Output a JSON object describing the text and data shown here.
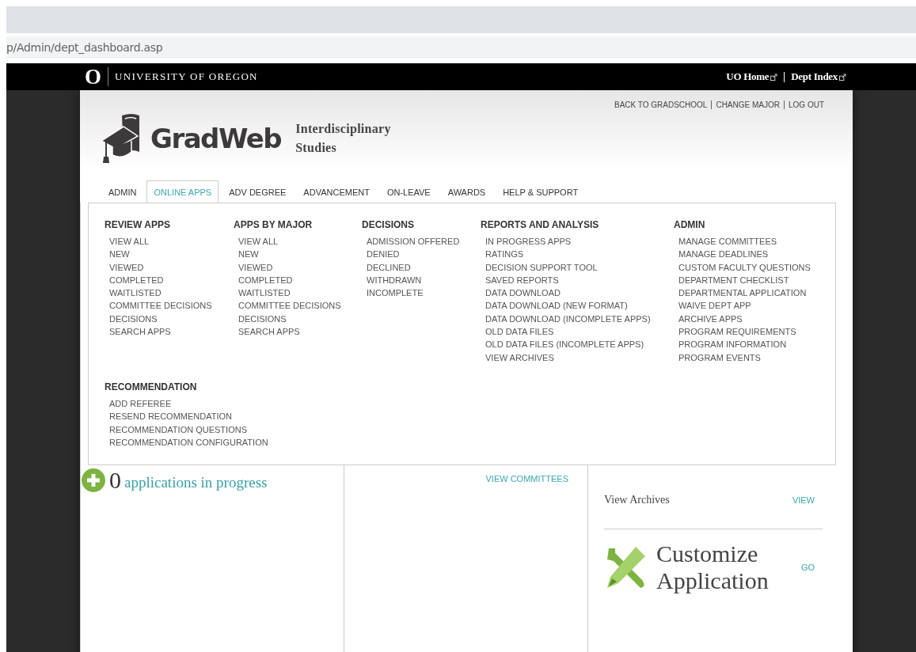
{
  "browser": {
    "url": "p/Admin/dept_dashboard.asp"
  },
  "top_bar": {
    "logo_letter": "O",
    "wordmark": "UNIVERSITY OF OREGON",
    "links": [
      "UO Home",
      "Dept Index"
    ]
  },
  "header": {
    "logo": "GradWeb",
    "department": "Interdisciplinary Studies",
    "utility_links": [
      "BACK TO GRADSCHOOL",
      "CHANGE MAJOR",
      "LOG OUT"
    ]
  },
  "tabs": [
    {
      "label": "ADMIN",
      "selected": false
    },
    {
      "label": "ONLINE APPS",
      "selected": true
    },
    {
      "label": "ADV DEGREE",
      "selected": false
    },
    {
      "label": "ADVANCEMENT",
      "selected": false
    },
    {
      "label": "ON-LEAVE",
      "selected": false
    },
    {
      "label": "AWARDS",
      "selected": false
    },
    {
      "label": "HELP & SUPPORT",
      "selected": false
    }
  ],
  "menu": {
    "sections": [
      {
        "title": "REVIEW APPS",
        "items": [
          "VIEW ALL",
          "NEW",
          "VIEWED",
          "COMPLETED",
          "WAITLISTED",
          "COMMITTEE DECISIONS",
          "DECISIONS",
          "SEARCH APPS"
        ]
      },
      {
        "title": "APPS BY MAJOR",
        "items": [
          "VIEW ALL",
          "NEW",
          "VIEWED",
          "COMPLETED",
          "WAITLISTED",
          "COMMITTEE DECISIONS",
          "DECISIONS",
          "SEARCH APPS"
        ]
      },
      {
        "title": "DECISIONS",
        "items": [
          "ADMISSION OFFERED",
          "DENIED",
          "DECLINED",
          "WITHDRAWN",
          "INCOMPLETE"
        ]
      },
      {
        "title": "REPORTS AND ANALYSIS",
        "items": [
          "IN PROGRESS APPS",
          "RATINGS",
          "DECISION SUPPORT TOOL",
          "SAVED REPORTS",
          "DATA DOWNLOAD",
          "DATA DOWNLOAD (NEW FORMAT)",
          "DATA DOWNLOAD (INCOMPLETE APPS)",
          "OLD DATA FILES",
          "OLD DATA FILES (INCOMPLETE APPS)",
          "VIEW ARCHIVES"
        ]
      },
      {
        "title": "ADMIN",
        "items": [
          "MANAGE COMMITTEES",
          "MANAGE DEADLINES",
          "CUSTOM FACULTY QUESTIONS",
          "DEPARTMENT CHECKLIST",
          "DEPARTMENTAL APPLICATION",
          "WAIVE DEPT APP",
          "ARCHIVE APPS",
          "PROGRAM REQUIREMENTS",
          "PROGRAM INFORMATION",
          "PROGRAM EVENTS"
        ]
      },
      {
        "title": "RECOMMENDATION",
        "items": [
          "ADD REFEREE",
          "RESEND RECOMMENDATION",
          "RECOMMENDATION QUESTIONS",
          "RECOMMENDATION CONFIGURATION"
        ]
      }
    ]
  },
  "dashboard": {
    "in_progress": {
      "count": "0",
      "label": "applications in progress"
    },
    "committees_link": "VIEW COMMITTEES",
    "archives": {
      "label": "View Archives",
      "action": "VIEW"
    },
    "customize": {
      "title": "Customize Application",
      "action": "GO"
    }
  }
}
